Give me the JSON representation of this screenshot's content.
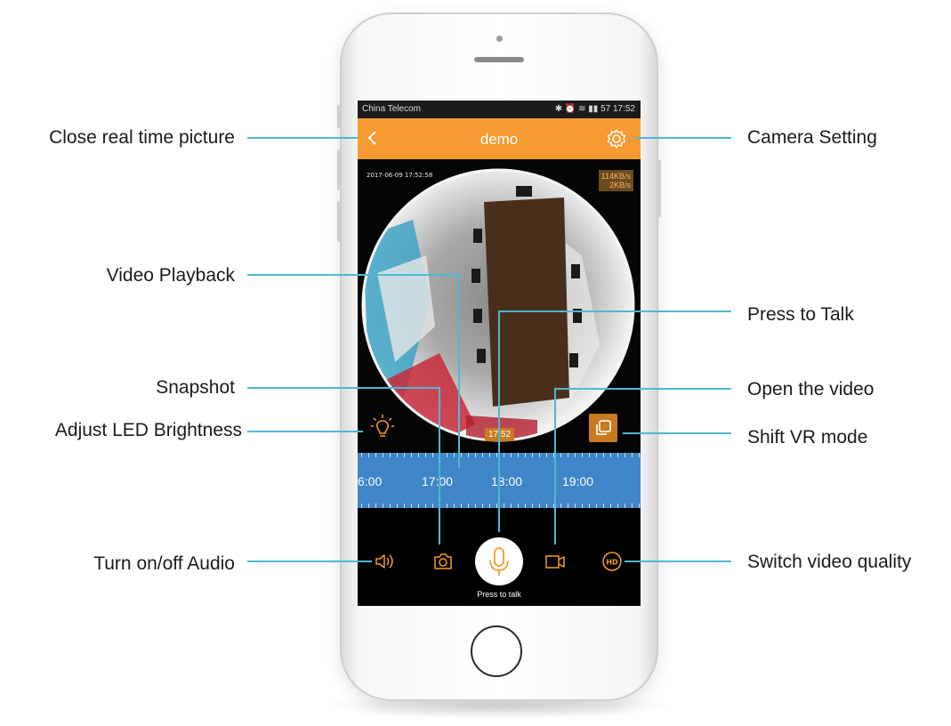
{
  "annotations": {
    "close_real_time_picture": "Close real time picture",
    "camera_setting": "Camera Setting",
    "video_playback": "Video Playback",
    "press_to_talk": "Press to Talk",
    "snapshot": "Snapshot",
    "open_the_video": "Open the video",
    "adjust_led_brightness": "Adjust LED Brightness",
    "shift_vr_mode": "Shift VR mode",
    "turn_on_off_audio": "Turn on/off Audio",
    "switch_video_quality": "Switch video quality"
  },
  "statusbar": {
    "carrier": "China Telecom",
    "icons": "✱ ⏰ ≋ ▮▮ 57",
    "time": "17:52"
  },
  "appbar": {
    "title": "demo",
    "back_icon": "chevron-left-icon",
    "settings_icon": "gear-icon"
  },
  "video": {
    "timestamp": "2017-06-09 17:52:58",
    "rate_down": "114KB/s",
    "rate_up": "2KB/s",
    "playback_time": "17:52"
  },
  "timeline": {
    "labels": [
      "6:00",
      "17:00",
      "18:00",
      "19:00"
    ]
  },
  "controls": {
    "press_to_talk_label": "Press to talk",
    "icons": [
      "speaker-icon",
      "camera-icon",
      "microphone-icon",
      "video-camera-icon",
      "hd-icon"
    ]
  },
  "colors": {
    "accent": "#f59b32",
    "timeline": "#3f86c8",
    "leader_line": "#4fb8d0"
  }
}
